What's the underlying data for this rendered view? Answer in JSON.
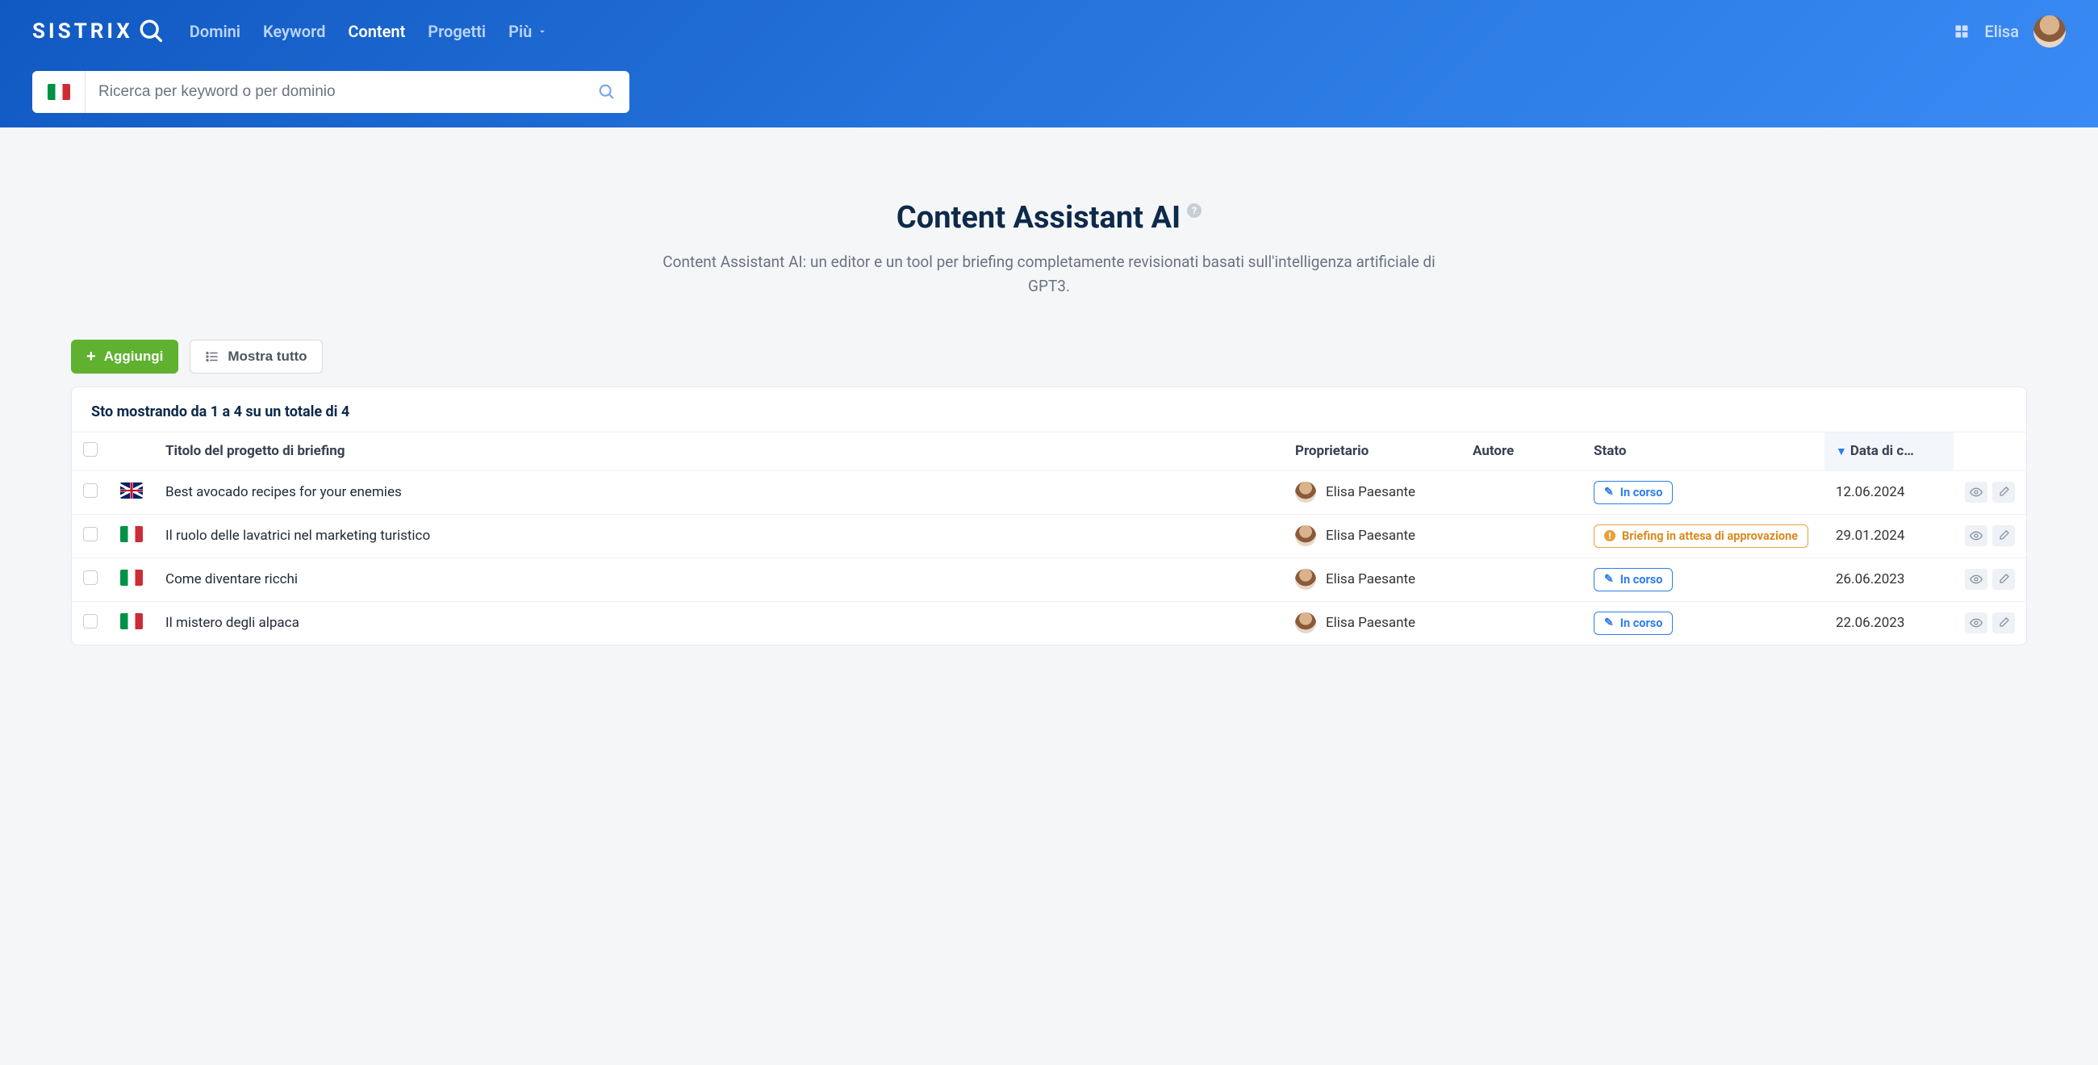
{
  "brand": "SISTRIX",
  "nav": {
    "items": [
      "Domini",
      "Keyword",
      "Content",
      "Progetti"
    ],
    "more_label": "Più",
    "active_index": 2
  },
  "user": {
    "name": "Elisa"
  },
  "search": {
    "placeholder": "Ricerca per keyword o per dominio"
  },
  "hero": {
    "title": "Content Assistant AI",
    "subtitle": "Content Assistant AI: un editor e un tool per briefing completamente revisionati basati sull'intelligenza artificiale di GPT3."
  },
  "toolbar": {
    "add_label": "Aggiungi",
    "show_all_label": "Mostra tutto"
  },
  "table": {
    "summary": "Sto mostrando da 1 a 4 su un totale di 4",
    "columns": {
      "title": "Titolo del progetto di briefing",
      "owner": "Proprietario",
      "author": "Autore",
      "status": "Stato",
      "date": "Data di c…"
    },
    "rows": [
      {
        "flag": "gb",
        "title": "Best avocado recipes for your enemies",
        "owner": "Elisa Paesante",
        "author": "",
        "status": {
          "kind": "blue",
          "label": "In corso"
        },
        "date": "12.06.2024"
      },
      {
        "flag": "it",
        "title": "Il ruolo delle lavatrici nel marketing turistico",
        "owner": "Elisa Paesante",
        "author": "",
        "status": {
          "kind": "orange",
          "label": "Briefing in attesa di approvazione"
        },
        "date": "29.01.2024"
      },
      {
        "flag": "it",
        "title": "Come diventare ricchi",
        "owner": "Elisa Paesante",
        "author": "",
        "status": {
          "kind": "blue",
          "label": "In corso"
        },
        "date": "26.06.2023"
      },
      {
        "flag": "it",
        "title": "Il mistero degli alpaca",
        "owner": "Elisa Paesante",
        "author": "",
        "status": {
          "kind": "blue",
          "label": "In corso"
        },
        "date": "22.06.2023"
      }
    ]
  }
}
